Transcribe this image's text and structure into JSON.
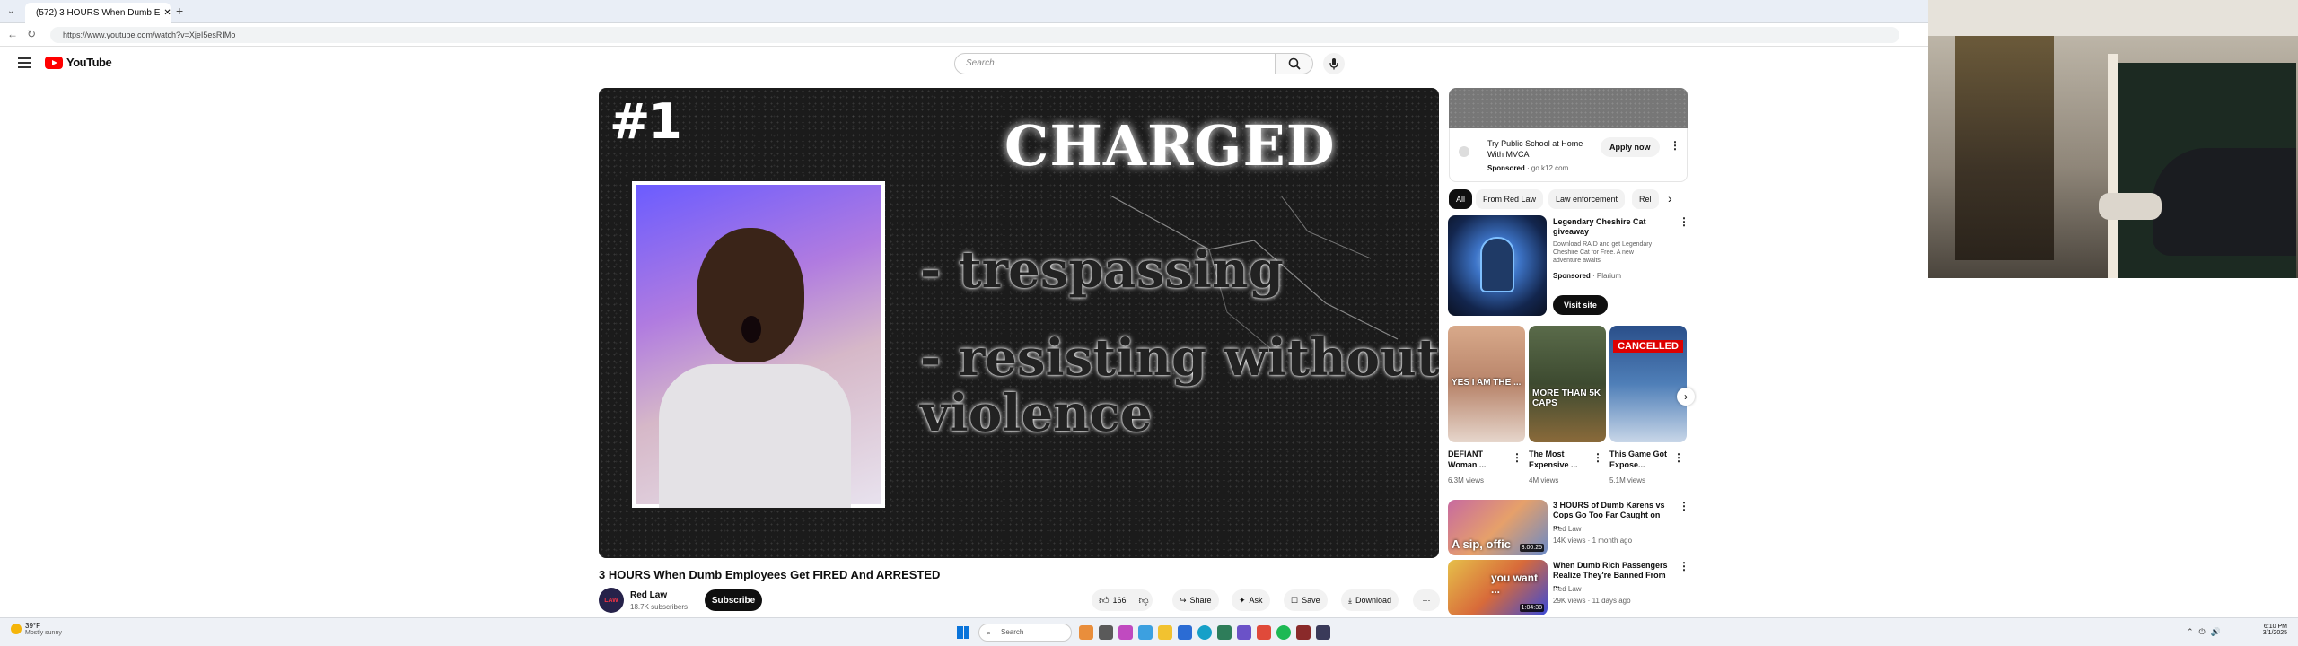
{
  "browser": {
    "tab_title": "(572) 3 HOURS When Dumb E",
    "url": "https://www.youtube.com/watch?v=XjeI5esRIMo"
  },
  "youtube": {
    "logo_text": "YouTube",
    "search_placeholder": "Search"
  },
  "player": {
    "rank": "#1",
    "heading": "CHARGED",
    "charges": [
      "- trespassing",
      "- resisting without",
      "violence"
    ]
  },
  "video": {
    "title": "3 HOURS When Dumb Employees Get FIRED And ARRESTED",
    "channel": "Red Law",
    "subscribers": "18.7K subscribers",
    "subscribe_label": "Subscribe",
    "like_count": "166",
    "share_label": "Share",
    "ask_label": "Ask",
    "save_label": "Save",
    "download_label": "Download",
    "avatar_text": "LAW"
  },
  "sidebar": {
    "ad": {
      "title": "Try Public School at Home With MVCA",
      "sponsor": "Sponsored",
      "domain": "go.k12.com",
      "apply_label": "Apply now"
    },
    "chips": [
      "All",
      "From Red Law",
      "Law enforcement",
      "Rel"
    ],
    "promo": {
      "title": "Legendary Cheshire Cat giveaway",
      "desc": "Download RAID and get Legendary Cheshire Cat for Free. A new adventure awaits",
      "sponsor": "Sponsored",
      "advertiser": "Plarium",
      "cta": "Visit site"
    },
    "shorts": [
      {
        "title": "DEFIANT Woman ...",
        "views": "6.3M views",
        "overlay": "YES I AM THE ..."
      },
      {
        "title": "The Most Expensive ...",
        "views": "4M views",
        "overlay": "MORE THAN 5K CAPS"
      },
      {
        "title": "This Game Got Expose...",
        "views": "5.1M views",
        "overlay": "CANCELLED"
      }
    ],
    "related": [
      {
        "title": "3 HOURS of Dumb Karens vs Cops Go Too Far Caught on ...",
        "channel": "Red Law",
        "meta": "14K views · 1 month ago",
        "duration": "3:00:25",
        "overlay": "A sip, offic"
      },
      {
        "title": "When Dumb Rich Passengers Realize They're Banned From ...",
        "channel": "Red Law",
        "meta": "29K views · 11 days ago",
        "duration": "1:04:38",
        "overlay": "you want ..."
      }
    ]
  },
  "taskbar": {
    "weather_temp": "39°F",
    "weather_desc": "Mostly sunny",
    "search_placeholder": "Search",
    "time": "6:10 PM",
    "date": "3/1/2025"
  },
  "colors": {
    "yt_red": "#ff0000",
    "subscribe_bg": "#0f0f0f",
    "chip_active_bg": "#0f0f0f",
    "chip_bg": "#f2f2f2",
    "meta_text": "#606060"
  },
  "icons": [
    "youtube-tab-icon",
    "menu-icon",
    "search-icon",
    "mic-icon",
    "like-icon",
    "dislike-icon",
    "share-icon",
    "ask-icon",
    "save-icon",
    "download-icon",
    "more-icon",
    "chevron-right-icon",
    "windows-start-icon",
    "weather-icon"
  ]
}
